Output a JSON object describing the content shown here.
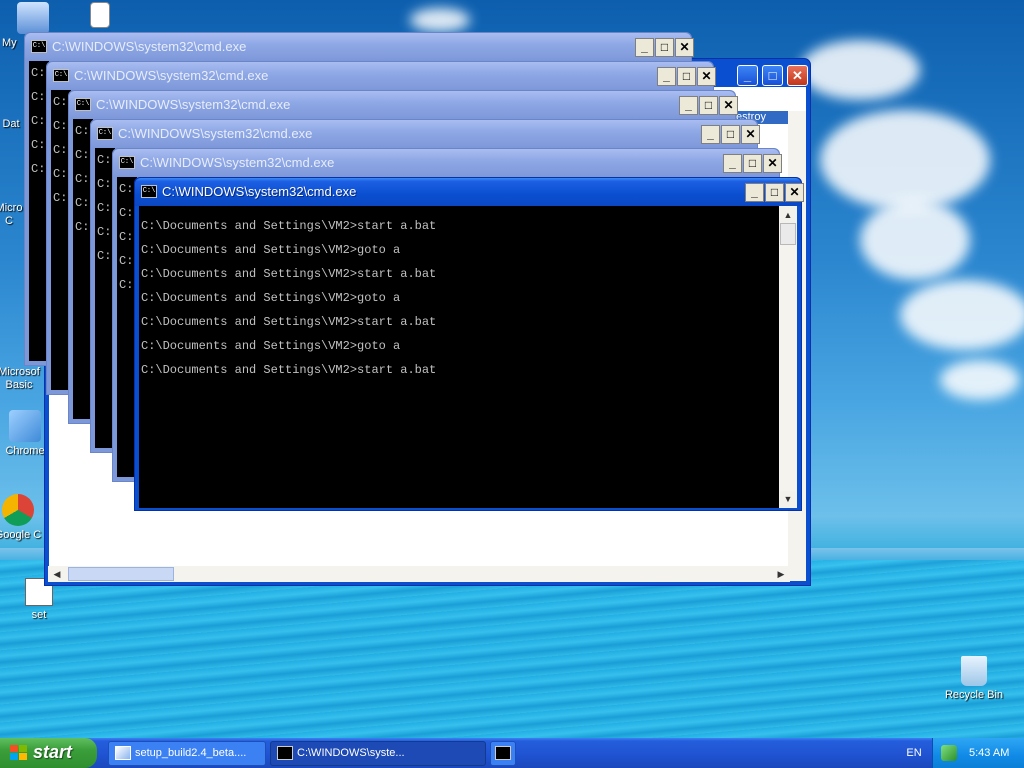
{
  "desktop": {
    "icons": [
      {
        "label": "My",
        "icon": "my-computer-icon"
      },
      {
        "label": "Dat",
        "icon": "data-file-icon"
      },
      {
        "label": "Micro C",
        "icon": "microsoft-office-icon"
      },
      {
        "label": "Microsof Basic",
        "icon": "microsoft-basic-icon"
      },
      {
        "label": "Chrome",
        "icon": "chrome-installer-icon"
      },
      {
        "label": "Google C",
        "icon": "google-chrome-icon"
      },
      {
        "label": "set",
        "icon": "setup-icon"
      },
      {
        "label": "Recycle Bin",
        "icon": "recycle-bin-icon"
      }
    ]
  },
  "explorer": {
    "selected_item": "estroy"
  },
  "cmd_windows": {
    "title": "C:\\WINDOWS\\system32\\cmd.exe",
    "icon_text": "C:\\",
    "prompt_fragment": "C:",
    "lines": [
      "C:\\Documents and Settings\\VM2>start a.bat",
      "C:\\Documents and Settings\\VM2>goto a",
      "C:\\Documents and Settings\\VM2>start a.bat",
      "C:\\Documents and Settings\\VM2>goto a",
      "C:\\Documents and Settings\\VM2>start a.bat",
      "C:\\Documents and Settings\\VM2>goto a",
      "C:\\Documents and Settings\\VM2>start a.bat"
    ],
    "minimize": "_",
    "maximize": "□",
    "close": "✕"
  },
  "taskbar": {
    "start_label": "start",
    "buttons": [
      {
        "label": "setup_build2.4_beta....",
        "icon": "installer-icon"
      },
      {
        "label": "C:\\WINDOWS\\syste...",
        "icon": "cmd-icon"
      },
      {
        "label": "",
        "icon": "cmd-icon"
      }
    ],
    "language": "EN",
    "clock": "5:43 AM",
    "colors": {
      "taskbar": "#245edc",
      "start": "#3a9e3a",
      "tray": "#0f8ae6"
    }
  }
}
